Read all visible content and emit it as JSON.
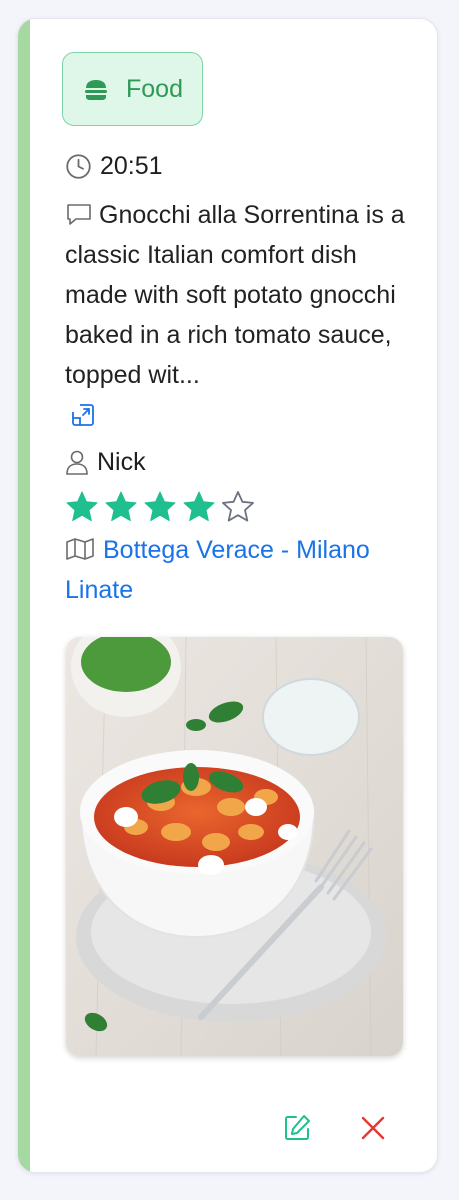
{
  "card": {
    "accent_color": "#a5d9a1",
    "category": {
      "label": "Food",
      "icon": "burger-icon",
      "color": "#2e9a55"
    },
    "time": {
      "icon": "clock-icon",
      "value": "20:51"
    },
    "description": {
      "icon": "comment-icon",
      "text": "Gnocchi alla Sorrentina is a classic Italian comfort dish made with soft potato gnocchi baked in a rich tomato sauce, topped wit...",
      "expand_icon": "expand-icon"
    },
    "user": {
      "icon": "user-icon",
      "name": "Nick"
    },
    "rating": {
      "value": 4,
      "max": 5,
      "filled_color": "#1fbf8f",
      "empty_color": "#6b7280"
    },
    "place": {
      "icon": "map-icon",
      "name": "Bottega Verace - Milano Linate",
      "color": "#1a73e8"
    },
    "photo": {
      "icon": "food-photo"
    },
    "actions": {
      "edit_icon": "edit-icon",
      "edit_color": "#1fbf8f",
      "delete_icon": "close-icon",
      "delete_color": "#e53935"
    }
  }
}
